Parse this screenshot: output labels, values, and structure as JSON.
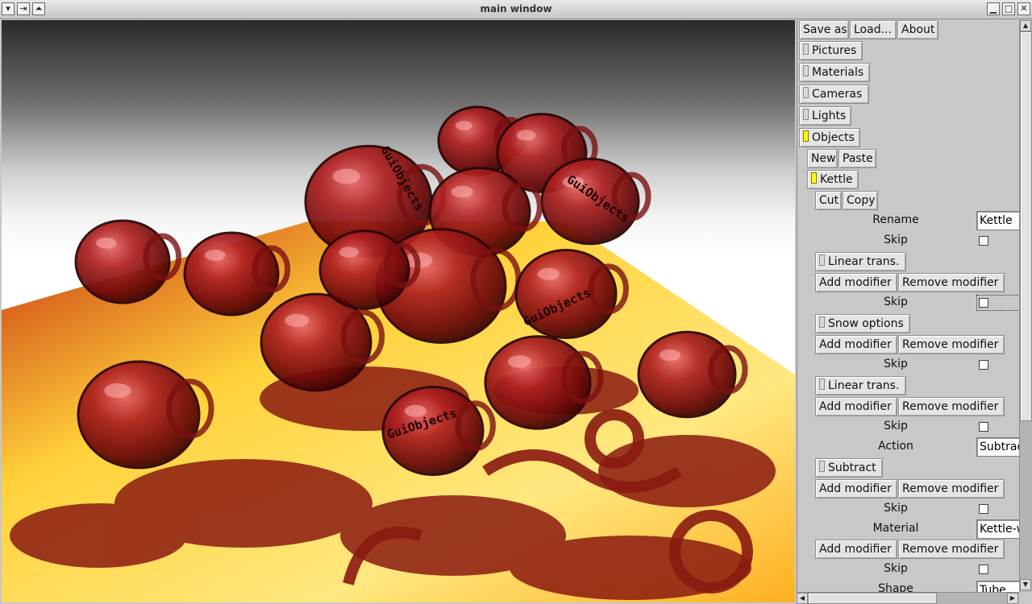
{
  "window": {
    "title": "main window",
    "left_buttons": [
      "▾",
      "⇥",
      "⏶"
    ],
    "right_buttons": [
      "▁",
      "□",
      "✕"
    ]
  },
  "toolbar": {
    "save_as": "Save as",
    "load": "Load...",
    "about": "About"
  },
  "sections": {
    "pictures": "Pictures",
    "materials": "Materials",
    "cameras": "Cameras",
    "lights": "Lights",
    "objects": "Objects"
  },
  "objects": {
    "new": "New",
    "paste": "Paste",
    "item_name": "Kettle",
    "cut": "Cut",
    "copy": "Copy",
    "rename_label": "Rename",
    "rename_value": "Kettle",
    "skip_label": "Skip"
  },
  "modifiers": {
    "linear_trans": "Linear trans.",
    "snow_options": "Snow options",
    "subtract": "Subtract",
    "add_modifier": "Add modifier",
    "remove_modifier": "Remove modifier",
    "action_label": "Action",
    "action_value": "Subtrac",
    "material_label": "Material",
    "material_value": "Kettle-w",
    "shape_label": "Shape",
    "shape_value": "Tube"
  },
  "render": {
    "scene_text": "GuiObjects",
    "colors": {
      "glass": "#8a0c0c",
      "glass_highlight": "#e05050",
      "floor_light": "#ffe14a",
      "floor_dark": "#8a1a10",
      "shadow": "#6e0f0a"
    }
  },
  "accent": {
    "toggle_on": "#ffff00"
  }
}
